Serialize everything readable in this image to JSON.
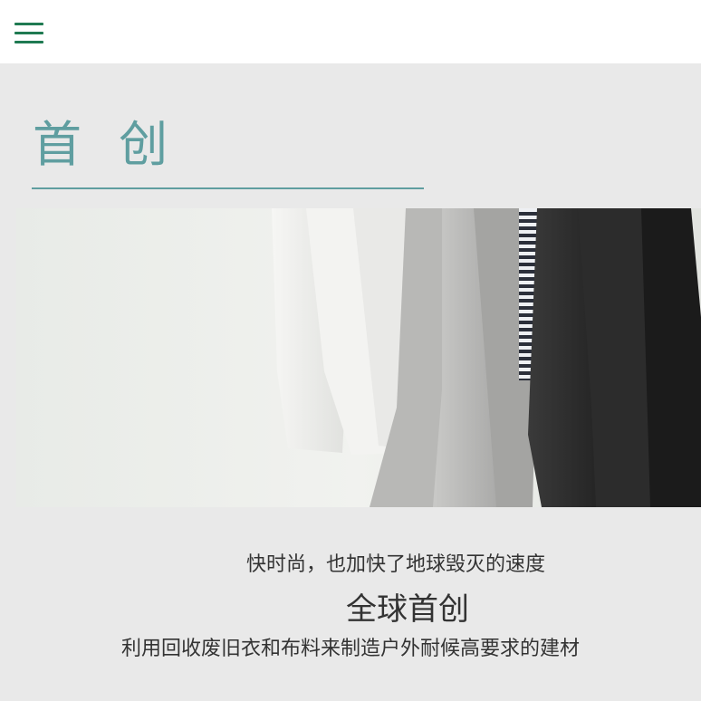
{
  "header": {
    "menu_icon": "hamburger-menu-icon",
    "accent_color": "#1f7a52"
  },
  "hero": {
    "title": "首 创",
    "title_color": "#5f9ea0",
    "image_subject": "clothes-rack-photo"
  },
  "content": {
    "line1": "快时尚，也加快了地球毁灭的速度",
    "line2": "全球首创",
    "line3": "利用回收废旧衣和布料来制造户外耐候高要求的建材"
  }
}
